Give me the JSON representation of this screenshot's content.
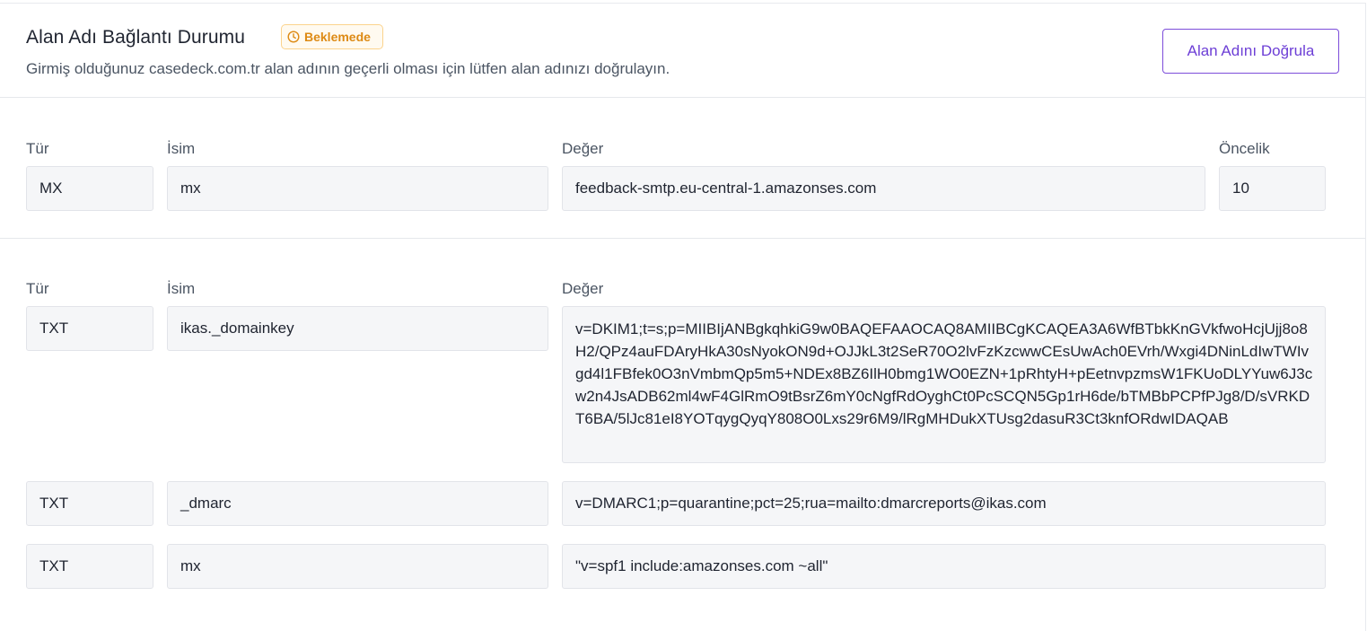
{
  "header": {
    "title": "Alan Adı Bağlantı Durumu",
    "badge": "Beklemede",
    "subtitle": "Girmiş olduğunuz casedeck.com.tr alan adının geçerli olması için lütfen alan adınızı doğrulayın.",
    "verify_button": "Alan Adını Doğrula",
    "badge_icon": "clock-icon",
    "accent_color": "#7c4dda",
    "badge_color": "#dd8a14"
  },
  "section1": {
    "labels": {
      "type": "Tür",
      "name": "İsim",
      "value": "Değer",
      "priority": "Öncelik"
    },
    "row": {
      "type": "MX",
      "name": "mx",
      "value": "feedback-smtp.eu-central-1.amazonses.com",
      "priority": "10"
    }
  },
  "section2": {
    "labels": {
      "type": "Tür",
      "name": "İsim",
      "value": "Değer"
    },
    "rows": [
      {
        "type": "TXT",
        "name": "ikas._domainkey",
        "value": "v=DKIM1;t=s;p=MIIBIjANBgkqhkiG9w0BAQEFAAOCAQ8AMIIBCgKCAQEA3A6WfBTbkKnGVkfwoHcjUjj8o8H2/QPz4auFDAryHkA30sNyokON9d+OJJkL3t2SeR70O2lvFzKzcwwCEsUwAch0EVrh/Wxgi4DNinLdIwTWIvgd4l1FBfek0O3nVmbmQp5m5+NDEx8BZ6IlH0bmg1WO0EZN+1pRhtyH+pEetnvpzmsW1FKUoDLYYuw6J3cw2n4JsADB62ml4wF4GlRmO9tBsrZ6mY0cNgfRdOyghCt0PcSCQN5Gp1rH6de/bTMBbPCPfPJg8/D/sVRKDT6BA/5lJc81eI8YOTqygQyqY808O0Lxs29r6M9/lRgMHDukXTUsg2dasuR3Ct3knfORdwIDAQAB"
      },
      {
        "type": "TXT",
        "name": "_dmarc",
        "value": "v=DMARC1;p=quarantine;pct=25;rua=mailto:dmarcreports@ikas.com"
      },
      {
        "type": "TXT",
        "name": "mx",
        "value": "\"v=spf1 include:amazonses.com ~all\""
      }
    ]
  }
}
